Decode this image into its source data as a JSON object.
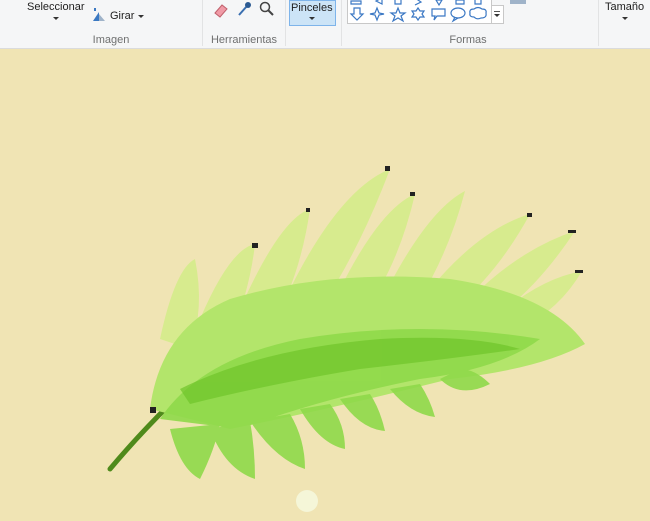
{
  "ribbon": {
    "image_group": {
      "label": "Imagen",
      "select_label": "Seleccionar",
      "rotate_label": "Girar"
    },
    "tools_group": {
      "label": "Herramientas"
    },
    "brushes_label": "Pinceles",
    "shapes_group": {
      "label": "Formas"
    },
    "size_label": "Tamaño"
  },
  "canvas": {
    "background": "#f0e4b4",
    "leaf_colors": [
      "#8fd94a",
      "#b3e56b",
      "#d6ec8c",
      "#6fc52a"
    ],
    "stem_color": "#4f8a1b"
  }
}
